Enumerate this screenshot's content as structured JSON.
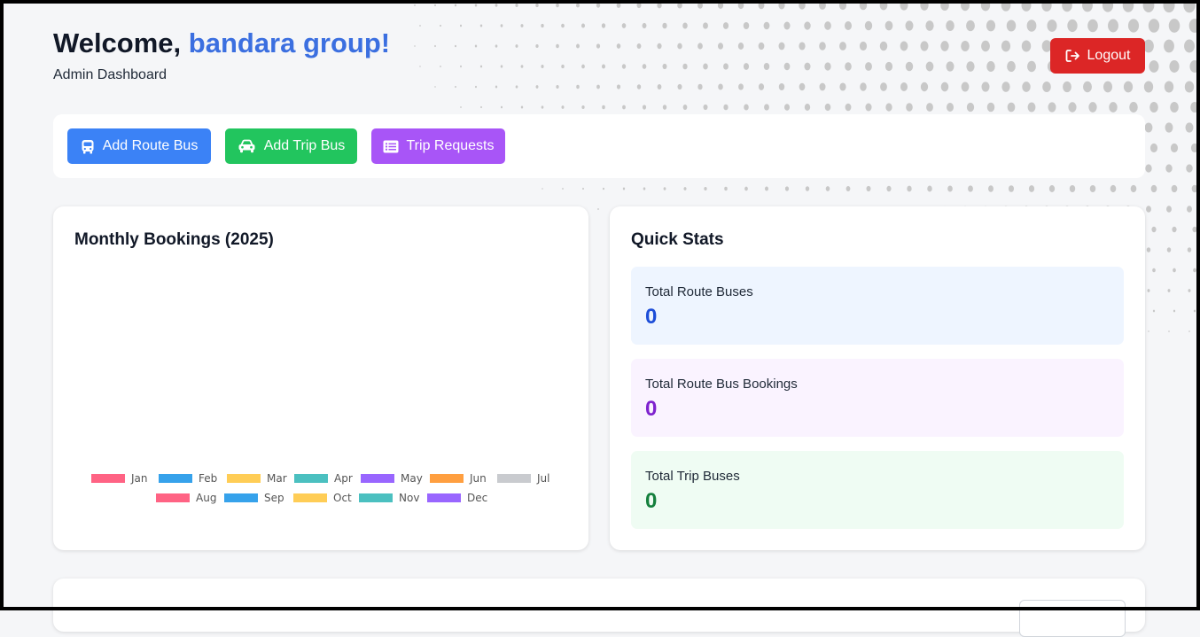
{
  "header": {
    "welcome_prefix": "Welcome, ",
    "username": "bandara group!",
    "subtitle": "Admin Dashboard"
  },
  "logout": {
    "label": "Logout",
    "icon": "sign-out-icon"
  },
  "actions": [
    {
      "label": "Add Route Bus",
      "icon": "bus-icon",
      "color": "#3b82f6"
    },
    {
      "label": "Add Trip Bus",
      "icon": "car-icon",
      "color": "#22c55e"
    },
    {
      "label": "Trip Requests",
      "icon": "list-icon",
      "color": "#a855f7"
    }
  ],
  "chart_data": {
    "type": "bar",
    "title": "Monthly Bookings (2025)",
    "categories": [
      "Jan",
      "Feb",
      "Mar",
      "Apr",
      "May",
      "Jun",
      "Jul",
      "Aug",
      "Sep",
      "Oct",
      "Nov",
      "Dec"
    ],
    "colors": [
      "#ff6384",
      "#36a2eb",
      "#ffcd56",
      "#4bc0c0",
      "#9966ff",
      "#ff9f40",
      "#c9cbcf",
      "#ff6384",
      "#36a2eb",
      "#ffcd56",
      "#4bc0c0",
      "#9966ff"
    ],
    "legend_position": "bottom"
  },
  "quick_stats": {
    "title": "Quick Stats",
    "items": [
      {
        "label": "Total Route Buses",
        "value": "0",
        "color": "#1d4ed8"
      },
      {
        "label": "Total Route Bus Bookings",
        "value": "0",
        "color": "#7e22ce"
      },
      {
        "label": "Total Trip Buses",
        "value": "0",
        "color": "#15803d"
      }
    ]
  }
}
